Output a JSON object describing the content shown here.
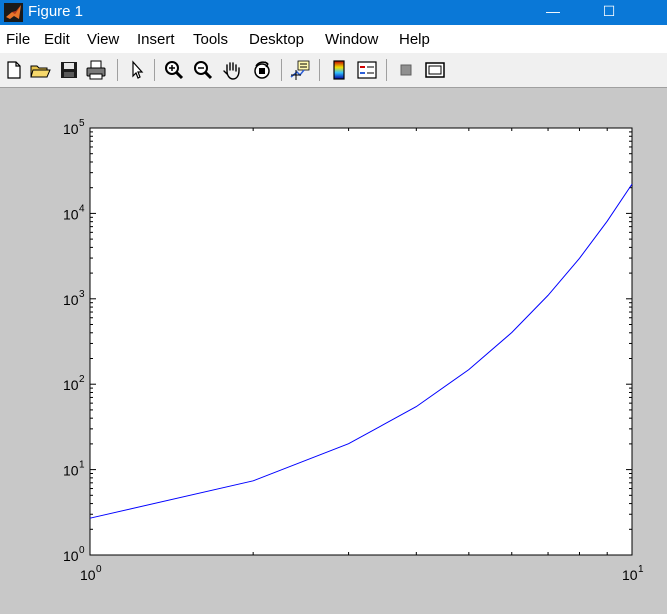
{
  "window": {
    "title": "Figure 1",
    "minimize_glyph": "—",
    "maximize_glyph": "☐",
    "accent": "#0a78d7"
  },
  "menubar": {
    "items": [
      "File",
      "Edit",
      "View",
      "Insert",
      "Tools",
      "Desktop",
      "Window",
      "Help"
    ]
  },
  "toolbar": {
    "buttons": [
      "new-file-icon",
      "open-folder-icon",
      "save-icon",
      "print-icon",
      "select-arrow-icon",
      "zoom-in-icon",
      "zoom-out-icon",
      "pan-hand-icon",
      "rotate-3d-icon",
      "data-cursor-icon",
      "colorbar-icon",
      "legend-icon",
      "hide-plot-tools-icon",
      "show-plot-tools-icon"
    ]
  },
  "chart_data": {
    "type": "line",
    "scale": {
      "x": "log",
      "y": "log"
    },
    "xlim": [
      1,
      10
    ],
    "ylim": [
      1,
      100000
    ],
    "x_ticks": [
      {
        "value": 1,
        "base": "10",
        "exp": "0"
      },
      {
        "value": 10,
        "base": "10",
        "exp": "1"
      }
    ],
    "y_ticks": [
      {
        "value": 1,
        "base": "10",
        "exp": "0"
      },
      {
        "value": 10,
        "base": "10",
        "exp": "1"
      },
      {
        "value": 100,
        "base": "10",
        "exp": "2"
      },
      {
        "value": 1000,
        "base": "10",
        "exp": "3"
      },
      {
        "value": 10000,
        "base": "10",
        "exp": "4"
      },
      {
        "value": 100000,
        "base": "10",
        "exp": "5"
      }
    ],
    "grid": false,
    "line_color": "#0000ff",
    "series": [
      {
        "x": [
          1,
          2,
          3,
          4,
          5,
          6,
          7,
          8,
          9,
          10
        ],
        "y": [
          2.7,
          7.4,
          20.1,
          54.6,
          148.4,
          403.4,
          1096.6,
          2981.0,
          8103.1,
          22026.5
        ]
      }
    ]
  }
}
